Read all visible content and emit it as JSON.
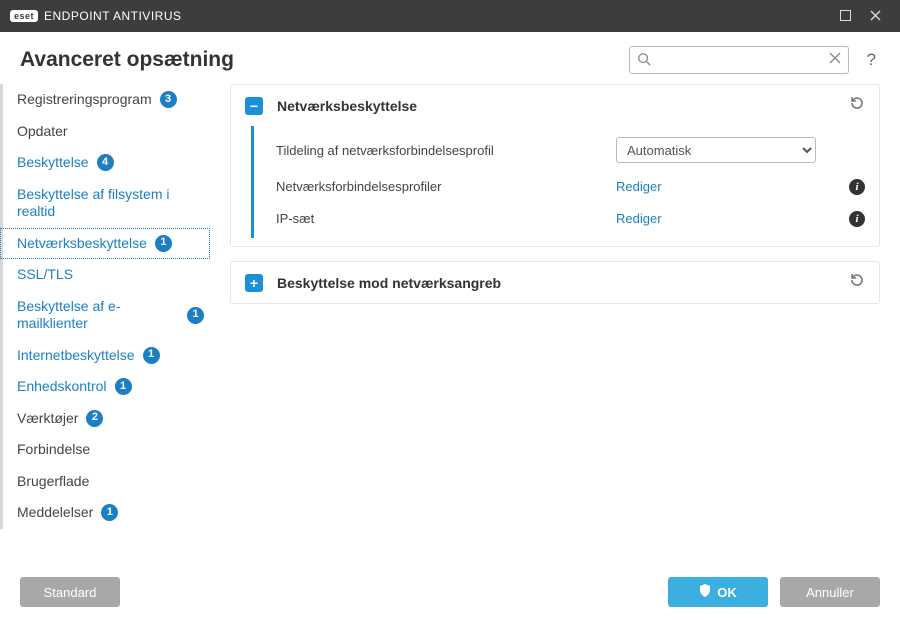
{
  "titlebar": {
    "brand_badge": "eset",
    "brand_text": "ENDPOINT ANTIVIRUS"
  },
  "header": {
    "title": "Avanceret opsætning",
    "search_placeholder": "",
    "help_label": "?"
  },
  "sidebar": [
    {
      "label": "Registreringsprogram",
      "badge": "3",
      "type": "top"
    },
    {
      "label": "Opdater",
      "type": "top"
    },
    {
      "label": "Beskyttelse",
      "badge": "4",
      "type": "top",
      "expanded": true
    },
    {
      "label": "Beskyttelse af filsystem i realtid",
      "type": "child"
    },
    {
      "label": "Netværksbeskyttelse",
      "badge": "1",
      "type": "child",
      "selected": true
    },
    {
      "label": "SSL/TLS",
      "type": "child"
    },
    {
      "label": "Beskyttelse af e-mailklienter",
      "badge": "1",
      "type": "child"
    },
    {
      "label": "Internetbeskyttelse",
      "badge": "1",
      "type": "child"
    },
    {
      "label": "Enhedskontrol",
      "badge": "1",
      "type": "child"
    },
    {
      "label": "Værktøjer",
      "badge": "2",
      "type": "top"
    },
    {
      "label": "Forbindelse",
      "type": "top"
    },
    {
      "label": "Brugerflade",
      "type": "top"
    },
    {
      "label": "Meddelelser",
      "badge": "1",
      "type": "top"
    }
  ],
  "panels": {
    "network": {
      "title": "Netværksbeskyttelse",
      "toggle_glyph": "−",
      "rows": {
        "profile_assign": {
          "label": "Tildeling af netværksforbindelsesprofil",
          "select_value": "Automatisk"
        },
        "profiles": {
          "label": "Netværksforbindelsesprofiler",
          "link": "Rediger"
        },
        "ipsets": {
          "label": "IP-sæt",
          "link": "Rediger"
        }
      }
    },
    "attack": {
      "title": "Beskyttelse mod netværksangreb",
      "toggle_glyph": "+"
    }
  },
  "footer": {
    "default": "Standard",
    "ok": "OK",
    "cancel": "Annuller"
  }
}
